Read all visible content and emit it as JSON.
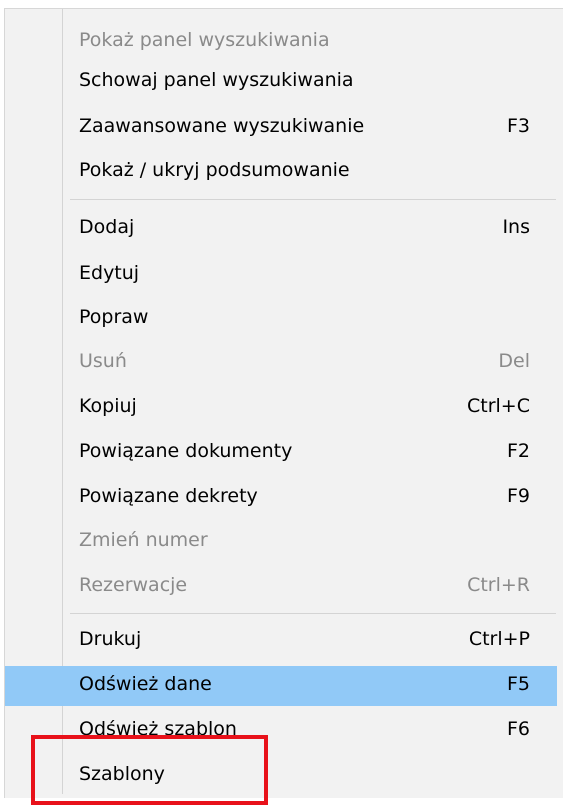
{
  "menu": {
    "items": [
      {
        "label": "Pokaż panel wyszukiwania",
        "shortcut": "",
        "state": "disabled"
      },
      {
        "label": "Schowaj panel wyszukiwania",
        "shortcut": "",
        "state": "enabled"
      },
      {
        "label": "Zaawansowane wyszukiwanie",
        "shortcut": "F3",
        "state": "enabled"
      },
      {
        "label": "Pokaż / ukryj podsumowanie",
        "shortcut": "",
        "state": "enabled"
      },
      {
        "label": "Dodaj",
        "shortcut": "Ins",
        "state": "enabled"
      },
      {
        "label": "Edytuj",
        "shortcut": "",
        "state": "enabled"
      },
      {
        "label": "Popraw",
        "shortcut": "",
        "state": "enabled"
      },
      {
        "label": "Usuń",
        "shortcut": "Del",
        "state": "disabled"
      },
      {
        "label": "Kopiuj",
        "shortcut": "Ctrl+C",
        "state": "enabled"
      },
      {
        "label": "Powiązane dokumenty",
        "shortcut": "F2",
        "state": "enabled"
      },
      {
        "label": "Powiązane dekrety",
        "shortcut": "F9",
        "state": "enabled"
      },
      {
        "label": "Zmień numer",
        "shortcut": "",
        "state": "disabled"
      },
      {
        "label": "Rezerwacje",
        "shortcut": "Ctrl+R",
        "state": "disabled"
      },
      {
        "label": "Drukuj",
        "shortcut": "Ctrl+P",
        "state": "enabled"
      },
      {
        "label": "Odśwież dane",
        "shortcut": "F5",
        "state": "highlighted"
      },
      {
        "label": "Odśwież szablon",
        "shortcut": "F6",
        "state": "enabled"
      },
      {
        "label": "Szablony",
        "shortcut": "",
        "state": "enabled"
      }
    ]
  },
  "colors": {
    "highlight": "#91c9f7",
    "disabled_text": "#8a8a8a",
    "annotation": "#e8111a"
  }
}
